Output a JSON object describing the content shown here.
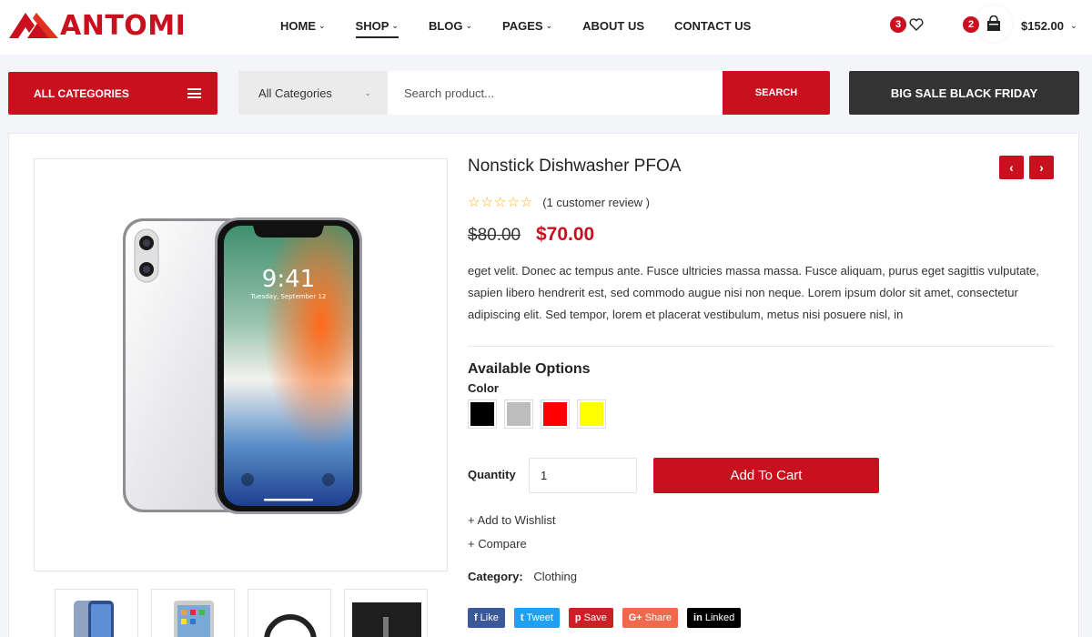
{
  "brand": {
    "name": "ANTOMI",
    "accent": "#c8101f"
  },
  "nav": [
    {
      "label": "HOME",
      "has_dropdown": true
    },
    {
      "label": "SHOP",
      "has_dropdown": true,
      "active": true
    },
    {
      "label": "BLOG",
      "has_dropdown": true
    },
    {
      "label": "PAGES",
      "has_dropdown": true
    },
    {
      "label": "ABOUT US",
      "has_dropdown": false
    },
    {
      "label": "CONTACT US",
      "has_dropdown": false
    }
  ],
  "header": {
    "wishlist_count": "3",
    "cart_count": "2",
    "cart_total": "$152.00"
  },
  "categories_button": "ALL CATEGORIES",
  "search": {
    "category": "All Categories",
    "placeholder": "Search product...",
    "button": "SEARCH"
  },
  "sale_button": "BIG SALE BLACK FRIDAY",
  "product": {
    "title": "Nonstick Dishwasher PFOA",
    "rating": 0,
    "review_text": "(1 customer review )",
    "old_price": "$80.00",
    "price": "$70.00",
    "description": "eget velit. Donec ac tempus ante. Fusce ultricies massa massa. Fusce aliquam, purus eget sagittis vulputate, sapien libero hendrerit est, sed commodo augue nisi non neque. Lorem ipsum dolor sit amet, consectetur adipiscing elit. Sed tempor, lorem et placerat vestibulum, metus nisi posuere nisl, in",
    "phone_time": "9:41",
    "phone_date": "Tuesday, September 12"
  },
  "options": {
    "title": "Available Options",
    "color_label": "Color",
    "colors": [
      "#000000",
      "#bdbdbd",
      "#ff0000",
      "#ffff00"
    ]
  },
  "quantity": {
    "label": "Quantity",
    "value": "1"
  },
  "add_to_cart": "Add To Cart",
  "links": {
    "wishlist": "+ Add to Wishlist",
    "compare": "+ Compare"
  },
  "category": {
    "label": "Category:",
    "value": "Clothing"
  },
  "share": [
    {
      "label": "Like",
      "glyph": "f",
      "color": "#3b5998",
      "icon": "facebook-icon"
    },
    {
      "label": "Tweet",
      "glyph": "t",
      "color": "#1da1f2",
      "icon": "twitter-icon"
    },
    {
      "label": "Save",
      "glyph": "p",
      "color": "#cb2027",
      "icon": "pinterest-icon"
    },
    {
      "label": "Share",
      "glyph": "G+",
      "color": "#f1694d",
      "icon": "google-plus-icon"
    },
    {
      "label": "Linked",
      "glyph": "in",
      "color": "#000000",
      "icon": "linkedin-icon"
    }
  ]
}
